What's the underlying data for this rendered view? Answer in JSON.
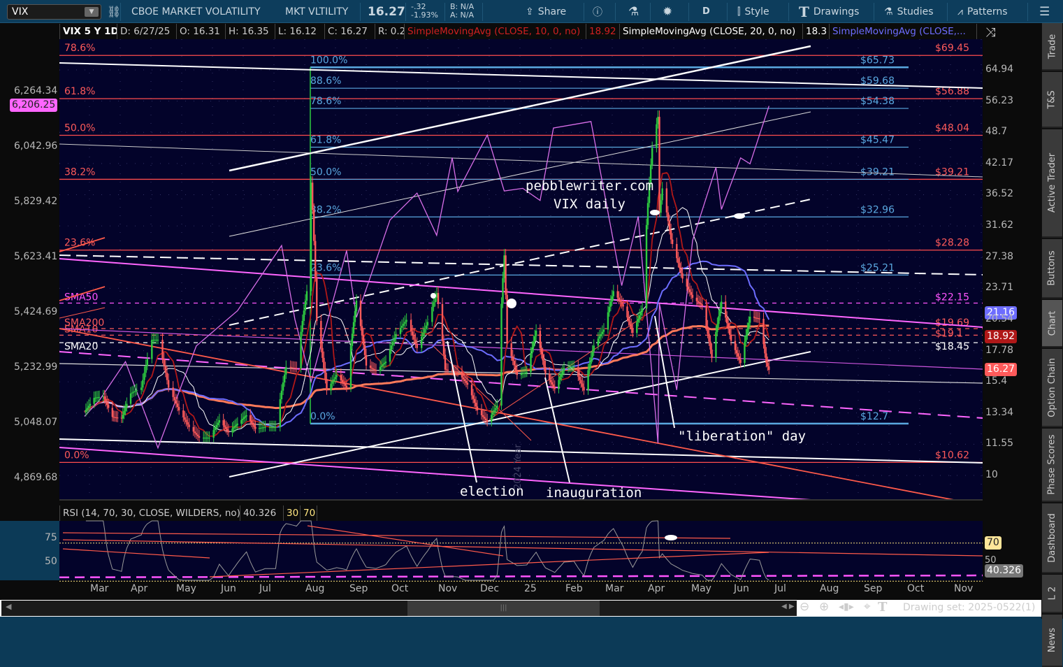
{
  "toolbar": {
    "symbol": "VIX",
    "description": "CBOE MARKET VOLATILITY",
    "short_name": "MKT VLTILITY",
    "last": "16.27",
    "change": "-.32",
    "change_pct": "-1.93%",
    "bid": "B: N/A",
    "ask": "A: N/A",
    "share": "Share",
    "aggregation": "D",
    "style": "Style",
    "drawings": "Drawings",
    "studies": "Studies",
    "patterns": "Patterns"
  },
  "legend": {
    "title": "VIX 5 Y 1D",
    "date": "D: 6/27/25",
    "open": "O: 16.31",
    "high": "H: 16.35",
    "low": "L: 16.12",
    "close": "C: 16.27",
    "range": "R: 0.23",
    "sma10": "SimpleMovingAvg (CLOSE, 10, 0, no)",
    "sma10_val": "18.92",
    "sma20": "SimpleMovingAvg (CLOSE, 20, 0, no)",
    "sma20_val": "18.3",
    "sma_other": "SimpleMovingAvg (CLOSE,..."
  },
  "rsi_legend": {
    "label": "RSI (14, 70, 30, CLOSE, WILDERS, no)",
    "value": "40.326",
    "low": "30",
    "high": "70"
  },
  "colors": {
    "bg": "#03032a",
    "up": "#2ecc40",
    "down": "#ff5a5a",
    "fib_red": "#ff4d4d",
    "fib_blue": "#5aa8e0",
    "overlay": "#d86ee8",
    "sma10": "#b01818",
    "sma20": "#ffffff",
    "sma50": "#6d6dff",
    "sma200": "#ff7a5a"
  },
  "price_axis": [
    "64.94",
    "56.23",
    "48.7",
    "42.17",
    "36.52",
    "31.62",
    "27.38",
    "23.71",
    "20.54",
    "17.78",
    "15.4",
    "13.34",
    "11.55",
    "10"
  ],
  "left_axis": [
    "6,264.34",
    "6,042.96",
    "5,829.42",
    "5,623.41",
    "5,424.69",
    "5,232.99",
    "5,048.07",
    "4,869.68"
  ],
  "price_tags": {
    "sma50": "21.16",
    "sma10": "18.92",
    "last": "16.27",
    "overlay": "6,206.25",
    "rsi_70": "70",
    "rsi_val": "40.326",
    "rsi_50": "50"
  },
  "rsi_axis": [
    "75",
    "50"
  ],
  "x_axis": [
    "Mar",
    "Apr",
    "May",
    "Jun",
    "Jul",
    "Aug",
    "Sep",
    "Oct",
    "Nov",
    "Dec",
    "25",
    "Feb",
    "Mar",
    "Apr",
    "May",
    "Jun",
    "Jul",
    "Aug",
    "Sep",
    "Oct",
    "Nov"
  ],
  "annotations": {
    "site": "pebblewriter.com",
    "sub": "VIX daily",
    "election": "election",
    "inauguration": "inauguration",
    "liberation": "\"liberation\" day",
    "year": "2024 Year"
  },
  "sma_labels": [
    {
      "name": "SMA50",
      "price": "$22.15"
    },
    {
      "name": "SMA200",
      "price": "$19.69"
    },
    {
      "name": "SMA10",
      "price": "$19.1"
    },
    {
      "name": "SMA20",
      "price": "$18.45"
    }
  ],
  "bottom": {
    "drawing_set": "Drawing set: 2025-0522(1)"
  },
  "sidebar": [
    "Trade",
    "T&S",
    "Active Trader",
    "Buttons",
    "Chart",
    "Option Chain",
    "Phase Scores",
    "Dashboard",
    "L 2",
    "News"
  ],
  "chart_data": {
    "type": "line",
    "title": "VIX 5 Y 1D",
    "y_scale": "log",
    "ylim": [
      9,
      75
    ],
    "fib_red": [
      {
        "pct": "78.6%",
        "price": "$69.45",
        "value": 69.45
      },
      {
        "pct": "61.8%",
        "price": "$56.88",
        "value": 56.88
      },
      {
        "pct": "50.0%",
        "price": "$48.04",
        "value": 48.04
      },
      {
        "pct": "38.2%",
        "price": "$39.21",
        "value": 39.21
      },
      {
        "pct": "23.6%",
        "price": "$28.28",
        "value": 28.28
      },
      {
        "pct": "0.0%",
        "price": "$10.62",
        "value": 10.62
      }
    ],
    "fib_blue": [
      {
        "pct": "100.0%",
        "price": "$65.73",
        "value": 65.73
      },
      {
        "pct": "88.6%",
        "price": "$59.68",
        "value": 59.68
      },
      {
        "pct": "78.6%",
        "price": "$54.38",
        "value": 54.38
      },
      {
        "pct": "61.8%",
        "price": "$45.47",
        "value": 45.47
      },
      {
        "pct": "50.0%",
        "price": "$39.21",
        "value": 39.21
      },
      {
        "pct": "38.2%",
        "price": "$32.96",
        "value": 32.96
      },
      {
        "pct": "23.6%",
        "price": "$25.21",
        "value": 25.21
      },
      {
        "pct": "0.0%",
        "price": "$12.7",
        "value": 12.7
      }
    ],
    "vix_close": [
      [
        "2024-02-26",
        13.4
      ],
      [
        "2024-03-04",
        14.3
      ],
      [
        "2024-03-11",
        14.4
      ],
      [
        "2024-03-18",
        13.1
      ],
      [
        "2024-03-25",
        13.0
      ],
      [
        "2024-04-01",
        14.6
      ],
      [
        "2024-04-08",
        15.0
      ],
      [
        "2024-04-15",
        18.7
      ],
      [
        "2024-04-19",
        18.7
      ],
      [
        "2024-04-26",
        15.0
      ],
      [
        "2024-05-03",
        13.5
      ],
      [
        "2024-05-10",
        12.5
      ],
      [
        "2024-05-17",
        11.9
      ],
      [
        "2024-05-24",
        11.9
      ],
      [
        "2024-05-31",
        12.9
      ],
      [
        "2024-06-07",
        12.2
      ],
      [
        "2024-06-14",
        12.7
      ],
      [
        "2024-06-21",
        13.2
      ],
      [
        "2024-06-28",
        12.4
      ],
      [
        "2024-07-05",
        12.5
      ],
      [
        "2024-07-12",
        12.5
      ],
      [
        "2024-07-19",
        16.5
      ],
      [
        "2024-07-26",
        16.4
      ],
      [
        "2024-08-02",
        23.4
      ],
      [
        "2024-08-05",
        38.6
      ],
      [
        "2024-08-09",
        20.4
      ],
      [
        "2024-08-16",
        14.8
      ],
      [
        "2024-08-23",
        15.9
      ],
      [
        "2024-08-30",
        15.0
      ],
      [
        "2024-09-06",
        22.4
      ],
      [
        "2024-09-13",
        16.6
      ],
      [
        "2024-09-20",
        16.2
      ],
      [
        "2024-09-27",
        16.9
      ],
      [
        "2024-10-04",
        19.2
      ],
      [
        "2024-10-11",
        20.5
      ],
      [
        "2024-10-18",
        18.0
      ],
      [
        "2024-10-25",
        20.3
      ],
      [
        "2024-10-31",
        23.2
      ],
      [
        "2024-11-06",
        16.3
      ],
      [
        "2024-11-15",
        16.1
      ],
      [
        "2024-11-22",
        15.2
      ],
      [
        "2024-11-29",
        13.5
      ],
      [
        "2024-12-06",
        12.8
      ],
      [
        "2024-12-13",
        13.8
      ],
      [
        "2024-12-18",
        27.6
      ],
      [
        "2024-12-20",
        18.4
      ],
      [
        "2024-12-27",
        15.9
      ],
      [
        "2025-01-03",
        16.1
      ],
      [
        "2025-01-10",
        19.5
      ],
      [
        "2025-01-17",
        16.0
      ],
      [
        "2025-01-24",
        14.9
      ],
      [
        "2025-01-31",
        16.4
      ],
      [
        "2025-02-07",
        16.5
      ],
      [
        "2025-02-14",
        14.8
      ],
      [
        "2025-02-21",
        18.2
      ],
      [
        "2025-02-28",
        19.6
      ],
      [
        "2025-03-07",
        23.4
      ],
      [
        "2025-03-14",
        21.8
      ],
      [
        "2025-03-21",
        19.3
      ],
      [
        "2025-03-28",
        21.6
      ],
      [
        "2025-04-04",
        45.3
      ],
      [
        "2025-04-08",
        52.3
      ],
      [
        "2025-04-09",
        33.6
      ],
      [
        "2025-04-11",
        37.6
      ],
      [
        "2025-04-17",
        29.7
      ],
      [
        "2025-04-25",
        24.8
      ],
      [
        "2025-05-02",
        22.7
      ],
      [
        "2025-05-09",
        21.9
      ],
      [
        "2025-05-16",
        17.2
      ],
      [
        "2025-05-23",
        22.3
      ],
      [
        "2025-05-30",
        18.6
      ],
      [
        "2025-06-06",
        16.8
      ],
      [
        "2025-06-13",
        20.8
      ],
      [
        "2025-06-20",
        20.6
      ],
      [
        "2025-06-25",
        16.8
      ],
      [
        "2025-06-27",
        16.27
      ]
    ],
    "overlay_spx": [
      [
        "2024-02-26",
        5070
      ],
      [
        "2024-03-08",
        5123
      ],
      [
        "2024-03-28",
        5254
      ],
      [
        "2024-04-19",
        4967
      ],
      [
        "2024-05-15",
        5308
      ],
      [
        "2024-06-14",
        5431
      ],
      [
        "2024-07-16",
        5667
      ],
      [
        "2024-07-25",
        5399
      ],
      [
        "2024-08-05",
        5186
      ],
      [
        "2024-08-30",
        5648
      ],
      [
        "2024-09-06",
        5408
      ],
      [
        "2024-09-30",
        5762
      ],
      [
        "2024-10-18",
        5864
      ],
      [
        "2024-10-31",
        5705
      ],
      [
        "2024-11-11",
        6001
      ],
      [
        "2024-11-15",
        5870
      ],
      [
        "2024-12-06",
        6090
      ],
      [
        "2024-12-18",
        5872
      ],
      [
        "2024-12-31",
        5882
      ],
      [
        "2025-01-13",
        5836
      ],
      [
        "2025-01-23",
        6118
      ],
      [
        "2025-02-19",
        6144
      ],
      [
        "2025-03-13",
        5521
      ],
      [
        "2025-03-25",
        5776
      ],
      [
        "2025-04-08",
        4982
      ],
      [
        "2025-04-09",
        5457
      ],
      [
        "2025-04-21",
        5158
      ],
      [
        "2025-05-02",
        5686
      ],
      [
        "2025-05-19",
        5963
      ],
      [
        "2025-05-23",
        5802
      ],
      [
        "2025-06-06",
        6000
      ],
      [
        "2025-06-13",
        5977
      ],
      [
        "2025-06-27",
        6206.25
      ]
    ],
    "rsi_levels": [
      30,
      50,
      70
    ]
  }
}
